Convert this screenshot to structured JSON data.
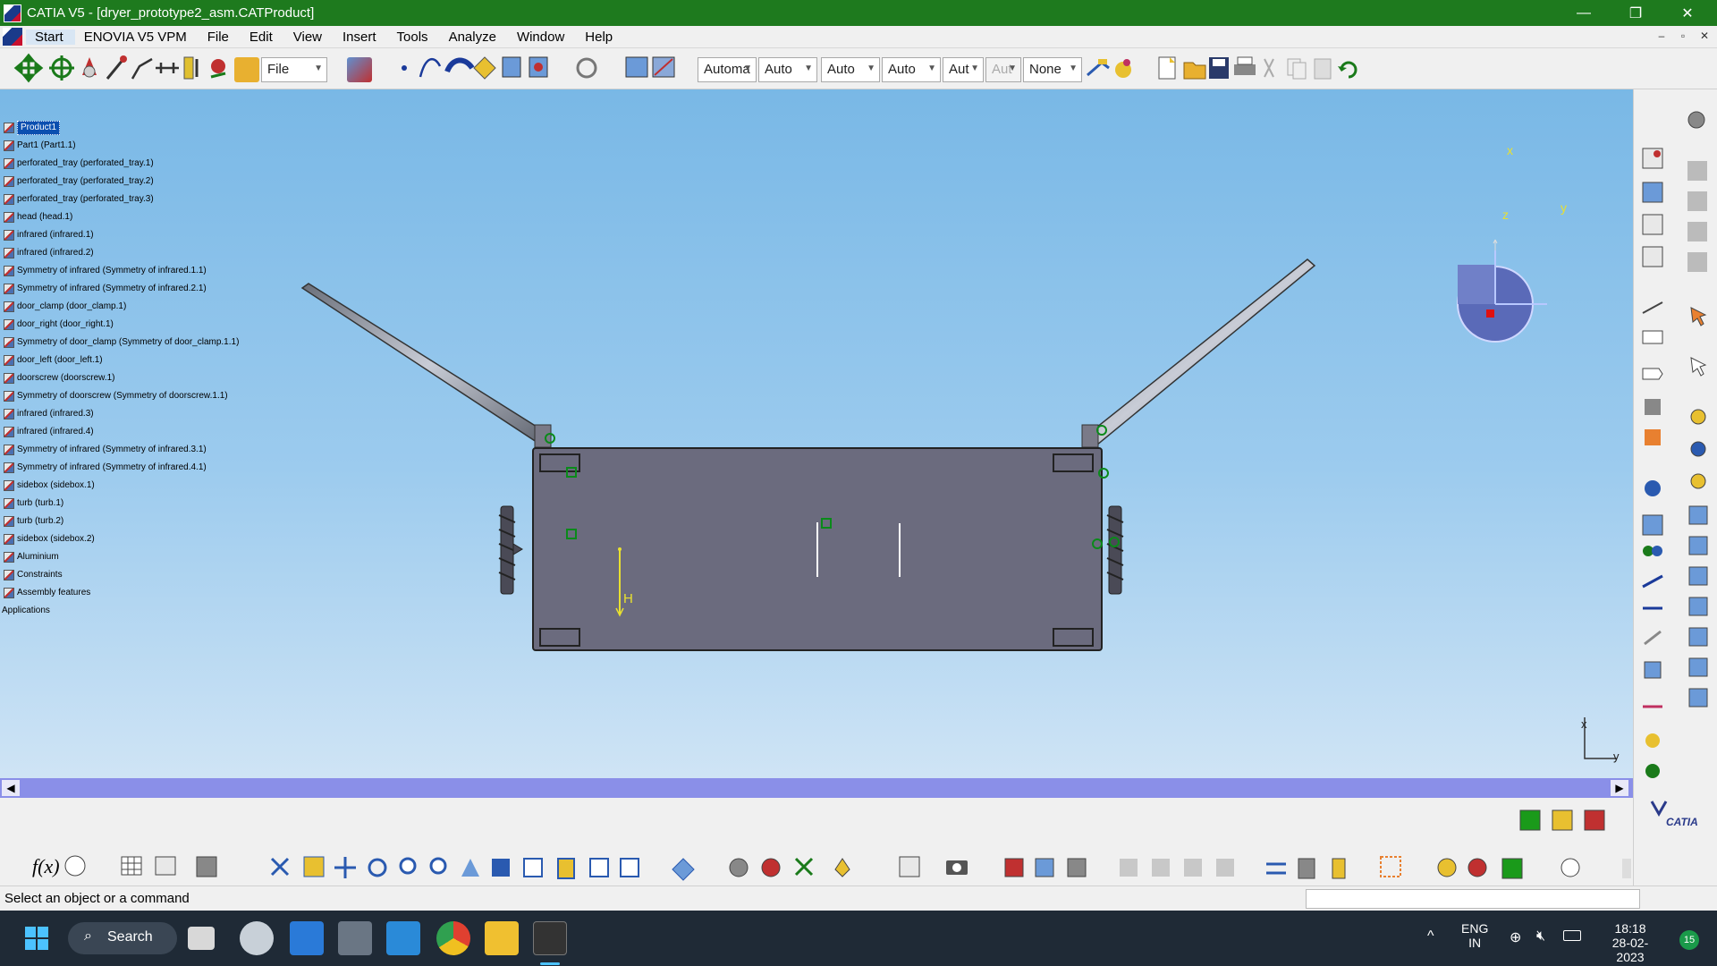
{
  "window": {
    "title": "CATIA V5 - [dryer_prototype2_asm.CATProduct]",
    "minimize": "—",
    "restore": "❐",
    "close": "✕"
  },
  "menu": {
    "items": [
      "Start",
      "ENOVIA V5 VPM",
      "File",
      "Edit",
      "View",
      "Insert",
      "Tools",
      "Analyze",
      "Window",
      "Help"
    ],
    "doc_controls": [
      "–",
      "▫",
      "✕"
    ]
  },
  "toolbar": {
    "file_combo": "File",
    "combos": [
      "Automa",
      "Auto",
      "Auto",
      "Auto",
      "Aut",
      "Aut",
      "None"
    ]
  },
  "tree": {
    "root": "Product1",
    "items": [
      "Part1 (Part1.1)",
      "perforated_tray (perforated_tray.1)",
      "perforated_tray (perforated_tray.2)",
      "perforated_tray (perforated_tray.3)",
      "head (head.1)",
      "infrared (infrared.1)",
      "infrared (infrared.2)",
      "Symmetry of infrared (Symmetry of infrared.1.1)",
      "Symmetry of infrared (Symmetry of infrared.2.1)",
      "door_clamp (door_clamp.1)",
      "door_right (door_right.1)",
      "Symmetry of door_clamp (Symmetry of door_clamp.1.1)",
      "door_left (door_left.1)",
      "doorscrew (doorscrew.1)",
      "Symmetry of doorscrew (Symmetry of doorscrew.1.1)",
      "infrared (infrared.3)",
      "infrared (infrared.4)",
      "Symmetry of infrared (Symmetry of infrared.3.1)",
      "Symmetry of infrared (Symmetry of infrared.4.1)",
      "sidebox (sidebox.1)",
      "turb (turb.1)",
      "turb (turb.2)",
      "sidebox (sidebox.2)",
      "Aluminium",
      "Constraints",
      "Assembly features"
    ],
    "applications": "Applications"
  },
  "compass": {
    "x": "x",
    "y": "y",
    "z": "z"
  },
  "axis_triad": {
    "x": "x",
    "y": "y"
  },
  "dimension_label": "H",
  "status": {
    "message": "Select an object or a command"
  },
  "taskbar": {
    "search": "Search",
    "lang1": "ENG",
    "lang2": "IN",
    "time": "18:18",
    "date": "28-02-2023",
    "notifications": "15"
  },
  "branding": {
    "catia": "CATIA"
  }
}
